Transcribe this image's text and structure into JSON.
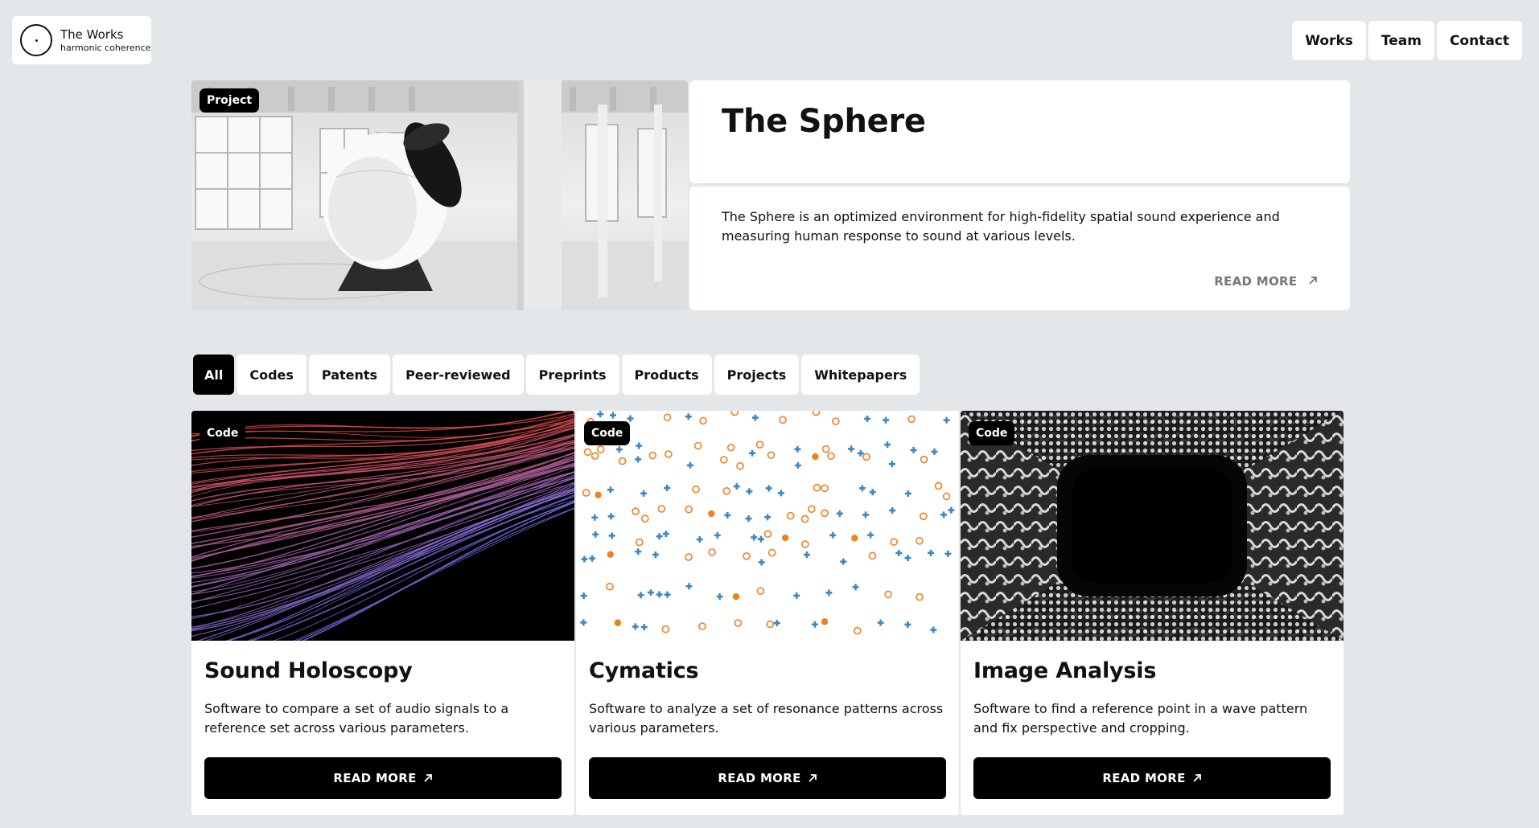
{
  "logo": {
    "title": "The Works",
    "subtitle": "harmonic coherence"
  },
  "nav": {
    "items": [
      "Works",
      "Team",
      "Contact"
    ]
  },
  "hero": {
    "badge": "Project",
    "title": "The Sphere",
    "description": "The Sphere is an optimized environment for high-fidelity spatial sound experience and measuring human response to sound at various levels.",
    "read_more": "READ MORE"
  },
  "filters": {
    "tabs": [
      "All",
      "Codes",
      "Patents",
      "Peer-reviewed",
      "Preprints",
      "Products",
      "Projects",
      "Whitepapers"
    ],
    "active": "All"
  },
  "cards": [
    {
      "badge": "Code",
      "title": "Sound Holoscopy",
      "description": "Software to compare a set of audio signals to a reference set across various parameters.",
      "button": "READ MORE"
    },
    {
      "badge": "Code",
      "title": "Cymatics",
      "description": "Software to analyze a set of resonance patterns across various parameters.",
      "button": "READ MORE"
    },
    {
      "badge": "Code",
      "title": "Image Analysis",
      "description": "Software to find a reference point in a wave pattern and fix perspective and cropping.",
      "button": "READ MORE"
    }
  ],
  "icons": {
    "logo": "circle-dot-logo-icon",
    "read_more": "arrow-up-right-icon"
  },
  "colors": {
    "background": "#e3e7ea",
    "accent": "#000000",
    "cymatics_orange": "#f07f1f",
    "cymatics_blue": "#3a88c4"
  }
}
